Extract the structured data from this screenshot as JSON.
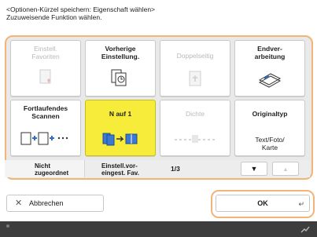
{
  "header": {
    "line1": "<Optionen-Kürzel speichern: Eigenschaft wählen>",
    "line2": "Zuzuweisende Funktion wählen."
  },
  "functions": [
    {
      "label_line1": "Einstell.",
      "label_line2": "Favoriten",
      "state": "disabled",
      "icon": "favorites-icon"
    },
    {
      "label_line1": "Vorherige",
      "label_line2": "Einstellung.",
      "state": "normal",
      "icon": "previous-settings-icon"
    },
    {
      "label_line1": "Doppelseitig",
      "label_line2": "",
      "state": "disabled",
      "icon": "duplex-icon"
    },
    {
      "label_line1": "Endver-",
      "label_line2": "arbeitung",
      "state": "normal",
      "icon": "finishing-icon"
    },
    {
      "label_line1": "Fortlaufendes",
      "label_line2": "Scannen",
      "state": "normal",
      "icon": "continuous-scan-icon"
    },
    {
      "label_line1": "N auf 1",
      "label_line2": "",
      "state": "selected",
      "icon": "n-on-1-icon"
    },
    {
      "label_line1": "Dichte",
      "label_line2": "",
      "state": "disabled",
      "icon": "density-icon"
    },
    {
      "label_line1": "Originaltyp",
      "label_line2": "",
      "state": "normal",
      "icon": "original-type-icon",
      "sub_line1": "Text/Foto/",
      "sub_line2": "Karte"
    }
  ],
  "assign_bar": {
    "slot1_line1": "Nicht",
    "slot1_line2": "zugeordnet",
    "slot2_line1": "Einstell.vor-",
    "slot2_line2": "eingest. Fav.",
    "page": "1/3"
  },
  "buttons": {
    "cancel": "Abbrechen",
    "ok": "OK"
  },
  "colors": {
    "highlight_frame": "#f2b477",
    "selected": "#f7ec3a"
  }
}
